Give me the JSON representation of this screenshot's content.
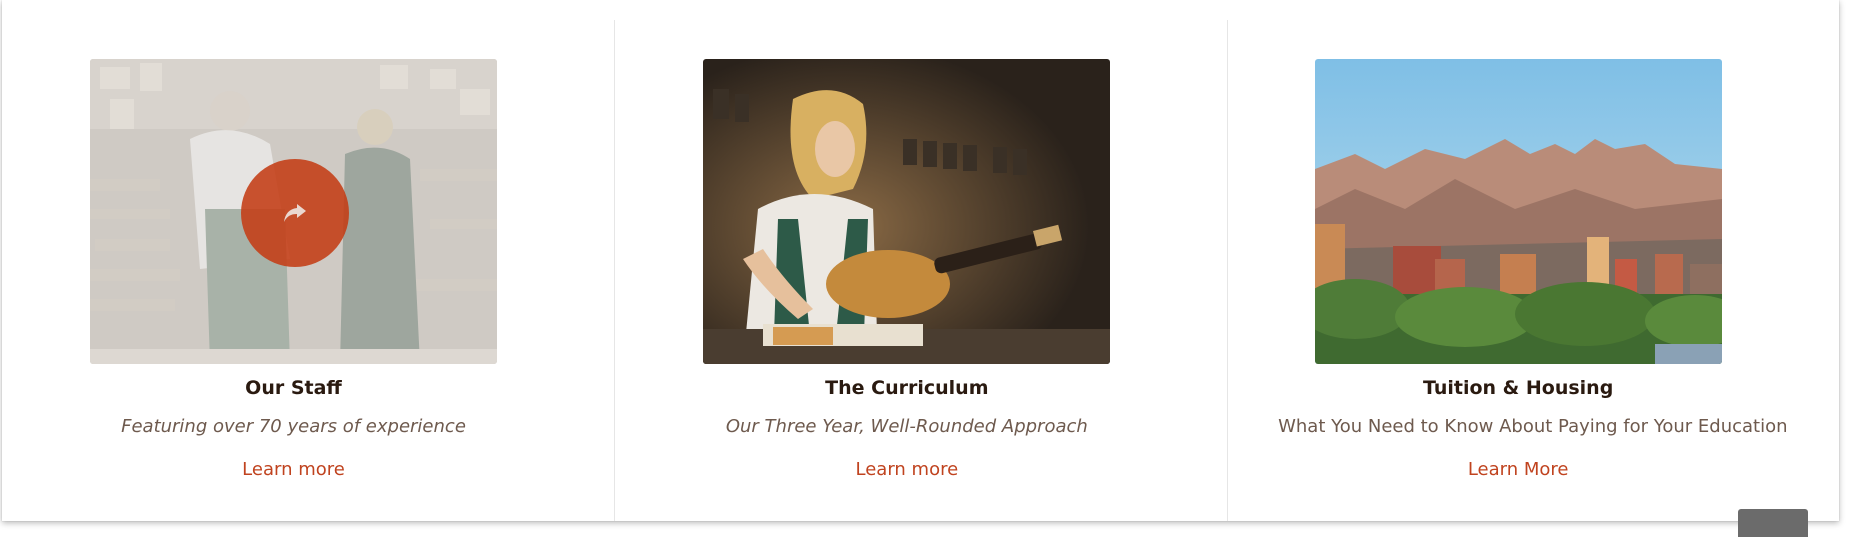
{
  "cards": [
    {
      "image": "staff-photo",
      "title": "Our Staff",
      "subtitle": "Featuring over 70 years of experience",
      "link": "Learn more",
      "overlay_icon": "share-arrow-icon"
    },
    {
      "image": "curriculum-photo",
      "title": "The Curriculum",
      "subtitle": "Our Three Year, Well-Rounded Approach",
      "link": "Learn more"
    },
    {
      "image": "city-mountain-photo",
      "title": "Tuition & Housing",
      "subtitle": "What You Need to Know About Paying for Your Education",
      "link": "Learn More"
    }
  ],
  "colors": {
    "accent": "#c0431f",
    "title": "#2a1a10",
    "subtitle": "#6e5a4e",
    "overlay": "#c43c14"
  }
}
